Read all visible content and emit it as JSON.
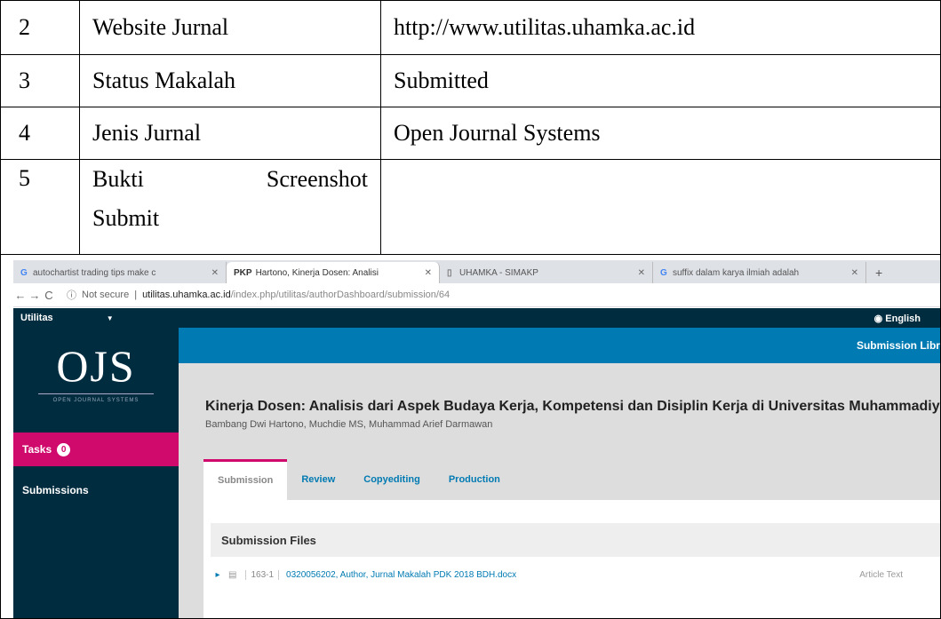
{
  "rows": [
    {
      "num": "2",
      "label": "Website Jurnal",
      "value": "http://www.utilitas.uhamka.ac.id"
    },
    {
      "num": "3",
      "label": "Status Makalah",
      "value": "Submitted"
    },
    {
      "num": "4",
      "label": "Jenis Jurnal",
      "value": "Open Journal Systems"
    },
    {
      "num": "5",
      "label_a": "Bukti",
      "label_b": "Screenshot",
      "label_c": "Submit",
      "value": ""
    }
  ],
  "browser": {
    "tabs": [
      {
        "favicon": "G",
        "title": "autochartist trading tips make c"
      },
      {
        "favicon": "PKP",
        "title": "Hartono, Kinerja Dosen: Analisi"
      },
      {
        "favicon": "doc",
        "title": "UHAMKA - SIMAKP"
      },
      {
        "favicon": "G",
        "title": "suffix dalam karya ilmiah adalah"
      }
    ],
    "address_security": "Not secure",
    "address_host": "utilitas.uhamka.ac.id",
    "address_path": "/index.php/utilitas/authorDashboard/submission/64"
  },
  "ojs": {
    "context_name": "Utilitas",
    "language": "English",
    "logo_text": "OJS",
    "logo_subtitle": "OPEN JOURNAL SYSTEMS",
    "tasks_label": "Tasks",
    "tasks_count": "0",
    "submissions_label": "Submissions",
    "bluebar_link": "Submission Library",
    "submission_title": "Kinerja Dosen: Analisis dari Aspek Budaya Kerja, Kompetensi dan Disiplin Kerja di Universitas Muhammadiyah Pro",
    "authors": "Bambang Dwi Hartono, Muchdie MS, Muhammad Arief Darmawan",
    "tabs": [
      "Submission",
      "Review",
      "Copyediting",
      "Production"
    ],
    "files_header": "Submission Files",
    "file": {
      "id": "163-1",
      "name": "0320056202, Author, Jurnal Makalah PDK 2018 BDH.docx",
      "type": "Article Text"
    }
  }
}
